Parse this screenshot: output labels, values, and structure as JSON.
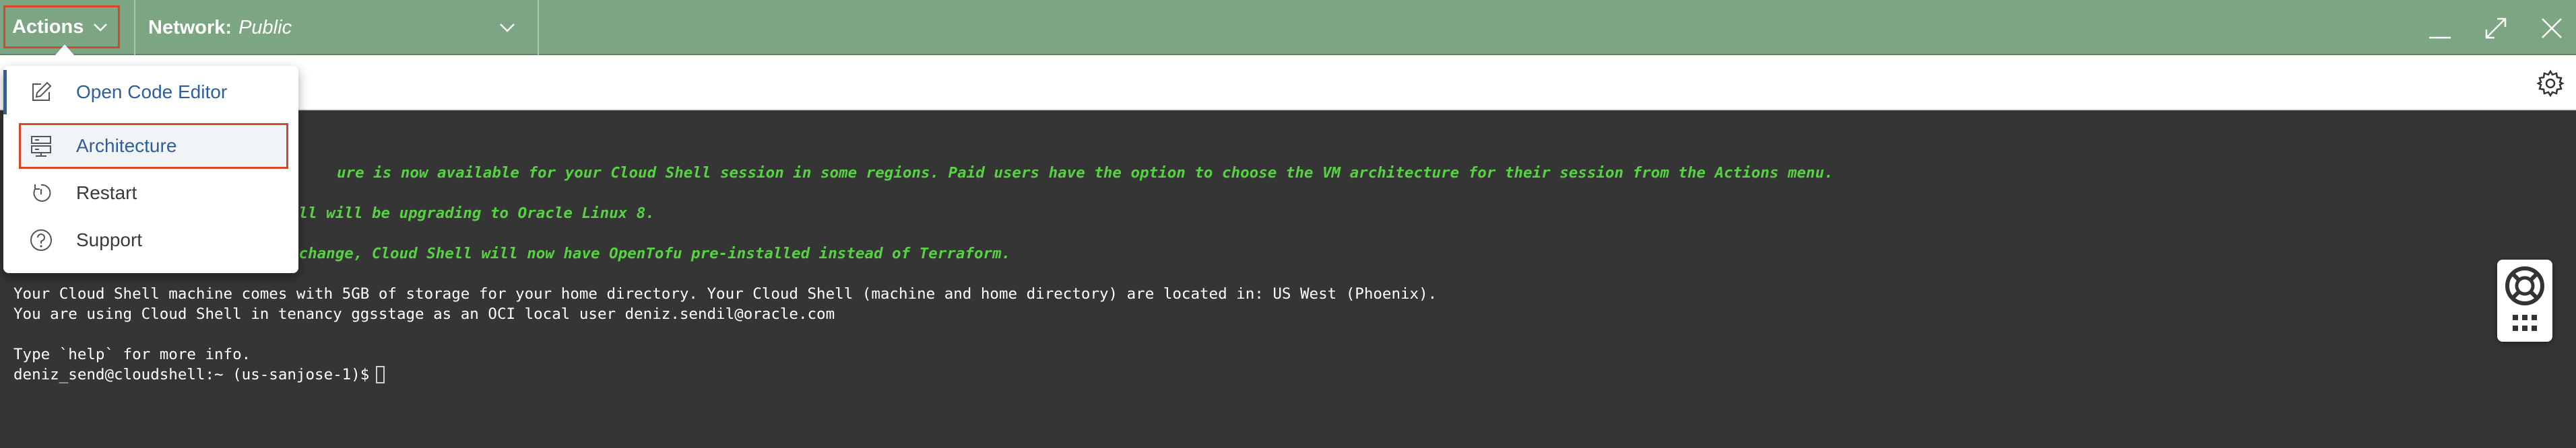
{
  "header": {
    "actions_label": "Actions",
    "network_label": "Network:",
    "network_value": "Public"
  },
  "menu": {
    "items": [
      {
        "label": "Open Code Editor",
        "icon": "edit-icon"
      },
      {
        "label": "Architecture",
        "icon": "architecture-icon"
      },
      {
        "label": "Restart",
        "icon": "restart-icon"
      },
      {
        "label": "Support",
        "icon": "help-circle-icon"
      }
    ],
    "selected": "Architecture"
  },
  "terminal": {
    "banner_lines": [
      "ure is now available for your Cloud Shell session in some regions. Paid users have the option to choose the VM architecture for their session from the Actions menu.",
      "ell will be upgrading to Oracle Linux 8.",
      " change, Cloud Shell will now have OpenTofu pre-installed instead of Terraform."
    ],
    "info_lines": [
      "Your Cloud Shell machine comes with 5GB of storage for your home directory. Your Cloud Shell (machine and home directory) are located in: US West (Phoenix).",
      "You are using Cloud Shell in tenancy ggsstage as an OCI local user deniz.sendil@oracle.com",
      "Type `help` for more info."
    ],
    "prompt": "deniz_send@cloudshell:~ (us-sanjose-1)$"
  },
  "colors": {
    "topbar": "#7ba583",
    "terminal_bg": "#353535",
    "banner_text": "#57d243",
    "highlight_border": "#d9472b",
    "menu_link": "#2e5f9c"
  },
  "icons": {
    "actions_chevron": "chevron-down-icon",
    "network_chevron": "chevron-down-icon",
    "minimize": "minimize-icon",
    "maximize": "maximize-icon",
    "close": "close-icon",
    "settings": "gear-icon",
    "help_widget": "lifebuoy-icon",
    "apps": "grid-icon"
  }
}
